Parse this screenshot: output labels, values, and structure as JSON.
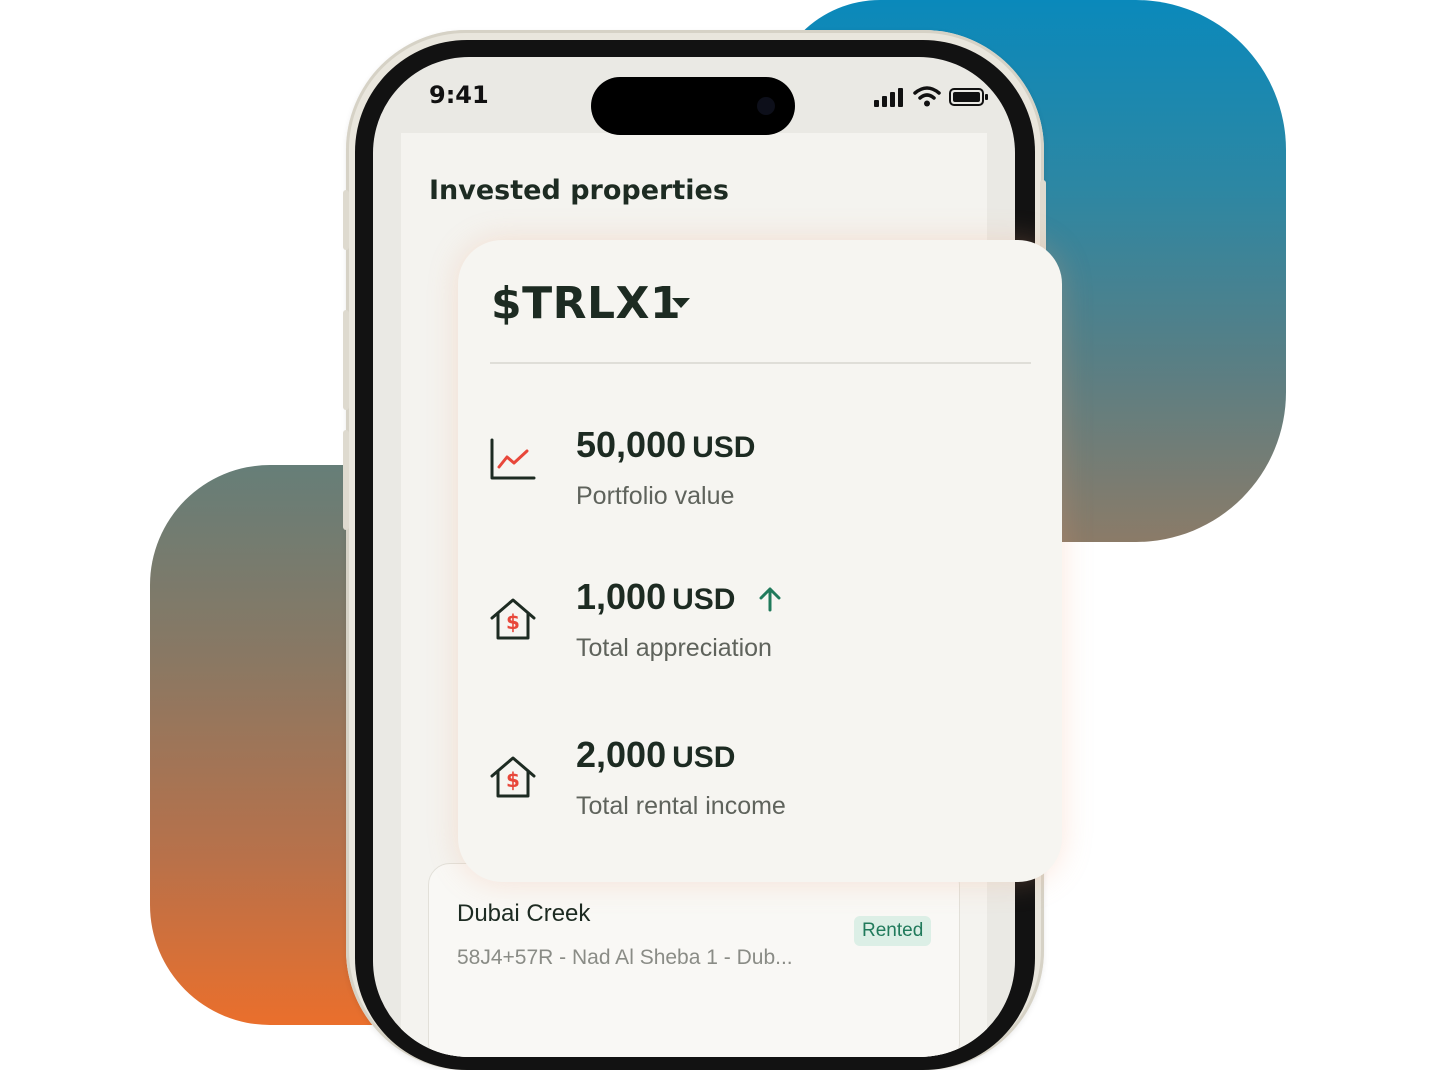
{
  "status_bar": {
    "time": "9:41"
  },
  "page": {
    "title": "Invested properties"
  },
  "summary": {
    "ticker": "$TRLX1",
    "stats": [
      {
        "value": "50,000",
        "unit": "USD",
        "label": "Portfolio value",
        "icon": "line-chart-icon"
      },
      {
        "value": "1,000",
        "unit": "USD",
        "label": "Total appreciation",
        "icon": "house-dollar-icon",
        "trend": "up"
      },
      {
        "value": "2,000",
        "unit": "USD",
        "label": "Total rental income",
        "icon": "house-dollar-icon"
      }
    ]
  },
  "property": {
    "name": "Dubai Creek",
    "address": "58J4+57R - Nad Al Sheba 1 - Dub...",
    "status": "Rented"
  },
  "colors": {
    "accent_red": "#e8473a",
    "accent_green": "#207a5b",
    "text_dark": "#1d2b22"
  }
}
